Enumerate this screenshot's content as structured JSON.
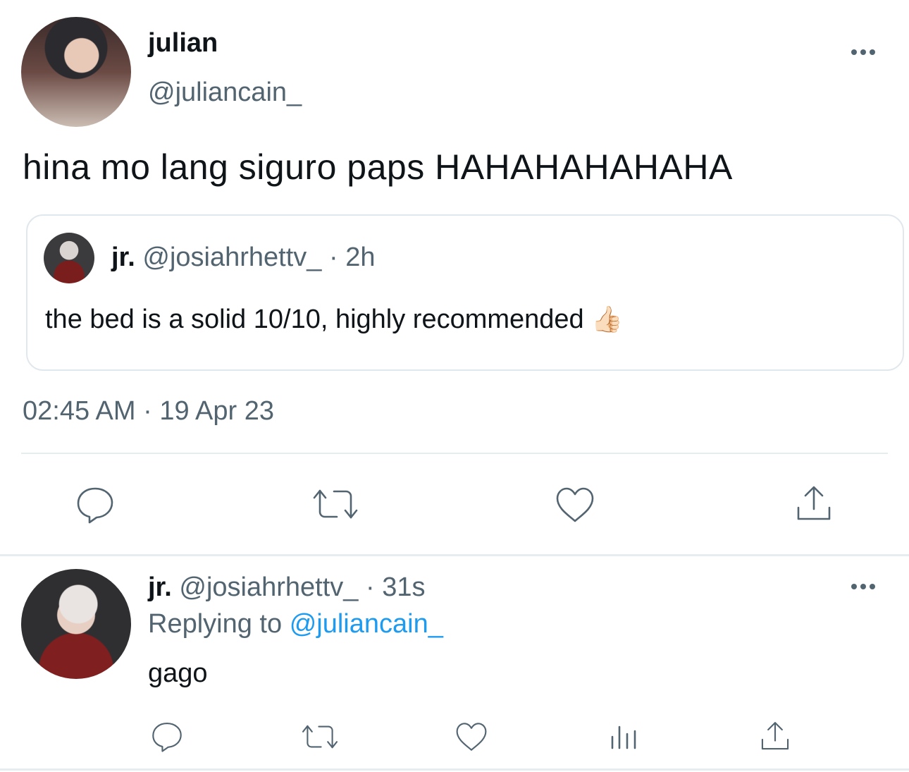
{
  "main_tweet": {
    "display_name": "julian",
    "handle": "@juliancain_",
    "text": "hina mo lang siguro paps HAHAHAHAHAHA",
    "timestamp": "02:45 AM · 19 Apr 23",
    "quoted": {
      "display_name": "jr.",
      "handle": "@josiahrhettv_",
      "time": "· 2h",
      "text": "the bed is a solid 10/10, highly recommended",
      "emoji": "👍🏻"
    },
    "actions": [
      "reply-icon",
      "retweet-icon",
      "like-icon",
      "share-icon"
    ]
  },
  "reply_tweet": {
    "display_name": "jr.",
    "handle": "@josiahrhettv_",
    "time": "· 31s",
    "replying_label": "Replying to",
    "replying_handle": "@juliancain_",
    "text": "gago",
    "actions": [
      "reply-icon",
      "retweet-icon",
      "like-icon",
      "analytics-icon",
      "share-icon"
    ]
  },
  "colors": {
    "text": "#0f1419",
    "muted": "#536471",
    "link": "#1d9bf0",
    "border": "#e1e8ed"
  }
}
